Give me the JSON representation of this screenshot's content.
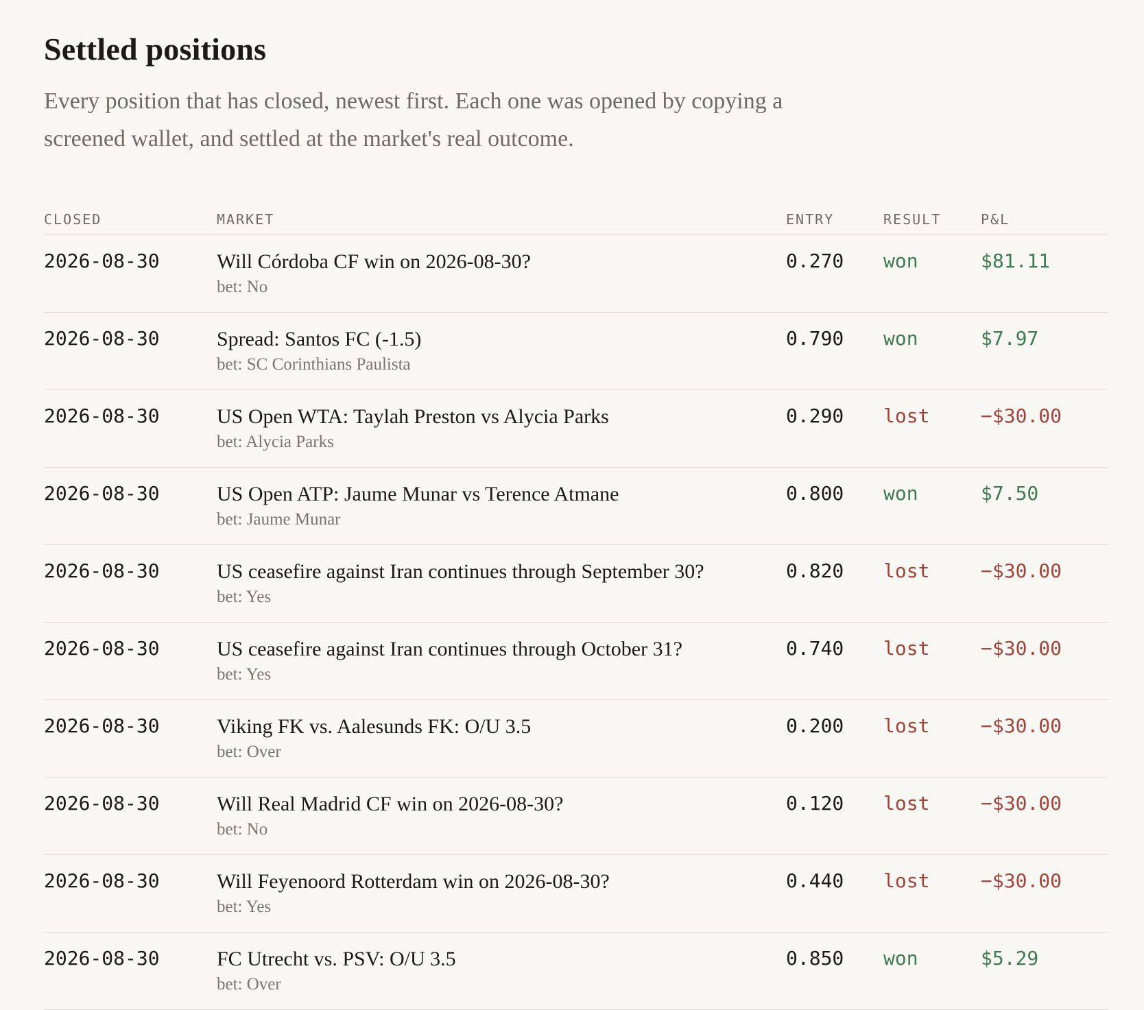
{
  "title": "Settled positions",
  "intro": "Every position that has closed, newest first. Each one was opened by copying a screened wallet, and settled at the market's real outcome.",
  "colors": {
    "won": "#3f7a52",
    "lost": "#a3443a",
    "background": "#f9f7f3"
  },
  "columns": {
    "closed": "CLOSED",
    "market": "MARKET",
    "entry": "ENTRY",
    "result": "RESULT",
    "pnl": "P&L"
  },
  "rows": [
    {
      "closed": "2026-08-30",
      "market": "Will Córdoba CF win on 2026-08-30?",
      "bet": "bet: No",
      "entry": "0.270",
      "result": "won",
      "pnl": "$81.11"
    },
    {
      "closed": "2026-08-30",
      "market": "Spread: Santos FC (-1.5)",
      "bet": "bet: SC Corinthians Paulista",
      "entry": "0.790",
      "result": "won",
      "pnl": "$7.97"
    },
    {
      "closed": "2026-08-30",
      "market": "US Open WTA: Taylah Preston vs Alycia Parks",
      "bet": "bet: Alycia Parks",
      "entry": "0.290",
      "result": "lost",
      "pnl": "−$30.00"
    },
    {
      "closed": "2026-08-30",
      "market": "US Open ATP: Jaume Munar vs Terence Atmane",
      "bet": "bet: Jaume Munar",
      "entry": "0.800",
      "result": "won",
      "pnl": "$7.50"
    },
    {
      "closed": "2026-08-30",
      "market": "US ceasefire against Iran continues through September 30?",
      "bet": "bet: Yes",
      "entry": "0.820",
      "result": "lost",
      "pnl": "−$30.00"
    },
    {
      "closed": "2026-08-30",
      "market": "US ceasefire against Iran continues through October 31?",
      "bet": "bet: Yes",
      "entry": "0.740",
      "result": "lost",
      "pnl": "−$30.00"
    },
    {
      "closed": "2026-08-30",
      "market": "Viking FK vs. Aalesunds FK: O/U 3.5",
      "bet": "bet: Over",
      "entry": "0.200",
      "result": "lost",
      "pnl": "−$30.00"
    },
    {
      "closed": "2026-08-30",
      "market": "Will Real Madrid CF win on 2026-08-30?",
      "bet": "bet: No",
      "entry": "0.120",
      "result": "lost",
      "pnl": "−$30.00"
    },
    {
      "closed": "2026-08-30",
      "market": "Will Feyenoord Rotterdam win on 2026-08-30?",
      "bet": "bet: Yes",
      "entry": "0.440",
      "result": "lost",
      "pnl": "−$30.00"
    },
    {
      "closed": "2026-08-30",
      "market": "FC Utrecht vs. PSV: O/U 3.5",
      "bet": "bet: Over",
      "entry": "0.850",
      "result": "won",
      "pnl": "$5.29"
    }
  ]
}
